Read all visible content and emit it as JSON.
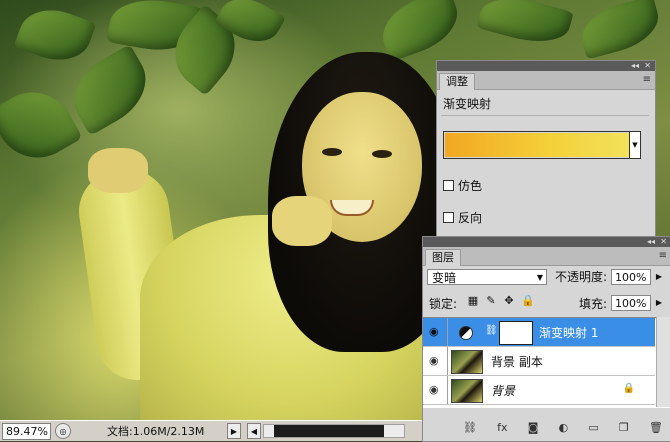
{
  "status": {
    "zoom": "89.47%",
    "doc_info": "文档:1.06M/2.13M"
  },
  "adjustments_panel": {
    "tab": "调整",
    "title": "渐变映射",
    "gradient_colors": [
      "#f2a722",
      "#f4cf38",
      "#f2e25a"
    ],
    "options": [
      {
        "label": "仿色",
        "checked": false
      },
      {
        "label": "反向",
        "checked": false
      }
    ]
  },
  "layers_panel": {
    "tab": "图层",
    "blend_mode": "变暗",
    "opacity_label": "不透明度:",
    "opacity_value": "100%",
    "lock_label": "锁定:",
    "fill_label": "填充:",
    "fill_value": "100%",
    "layers": [
      {
        "name": "渐变映射 1",
        "selected": true,
        "type": "adjustment"
      },
      {
        "name": "背景 副本",
        "selected": false,
        "type": "image"
      },
      {
        "name": "背景",
        "selected": false,
        "type": "image",
        "locked": true
      }
    ],
    "footer_icons": [
      "link-icon",
      "fx-icon",
      "mask-icon",
      "adjustment-icon",
      "group-icon",
      "new-layer-icon",
      "trash-icon"
    ]
  },
  "colors": {
    "selection": "#3a8ee6",
    "panel_bg": "#d6d6d6"
  }
}
